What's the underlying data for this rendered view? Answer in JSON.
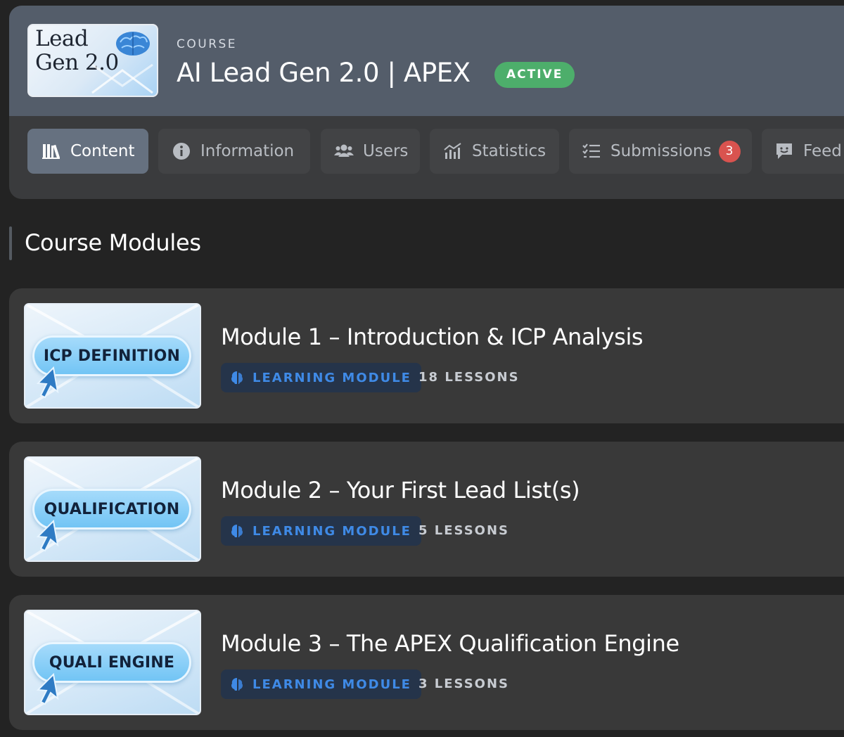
{
  "course": {
    "kicker": "COURSE",
    "title": "AI Lead Gen 2.0 | APEX",
    "status": "ACTIVE",
    "thumbnail": {
      "line1": "Lead",
      "line2": "Gen 2.0"
    }
  },
  "tabs": [
    {
      "label": "Content",
      "icon": "books-icon",
      "active": true
    },
    {
      "label": "Information",
      "icon": "info-icon",
      "active": false
    },
    {
      "label": "Users",
      "icon": "users-icon",
      "active": false
    },
    {
      "label": "Statistics",
      "icon": "chart-icon",
      "active": false
    },
    {
      "label": "Submissions",
      "icon": "checklist-icon",
      "active": false,
      "badge": "3"
    },
    {
      "label": "Feed",
      "icon": "feedback-icon",
      "active": false
    }
  ],
  "section": {
    "title": "Course Modules"
  },
  "modules": [
    {
      "title": "Module 1 – Introduction & ICP Analysis",
      "tag": "LEARNING MODULE",
      "lessons": "18 LESSONS",
      "thumb_label": "ICP DEFINITION"
    },
    {
      "title": "Module 2 – Your First Lead List(s)",
      "tag": "LEARNING MODULE",
      "lessons": "5 LESSONS",
      "thumb_label": "QUALIFICATION"
    },
    {
      "title": "Module 3 – The APEX Qualification Engine",
      "tag": "LEARNING MODULE",
      "lessons": "3 LESSONS",
      "thumb_label": "QUALI ENGINE"
    }
  ],
  "colors": {
    "active_badge": "#4dae6b",
    "tag_text": "#3f8ae6",
    "notification_badge": "#d9534f"
  }
}
